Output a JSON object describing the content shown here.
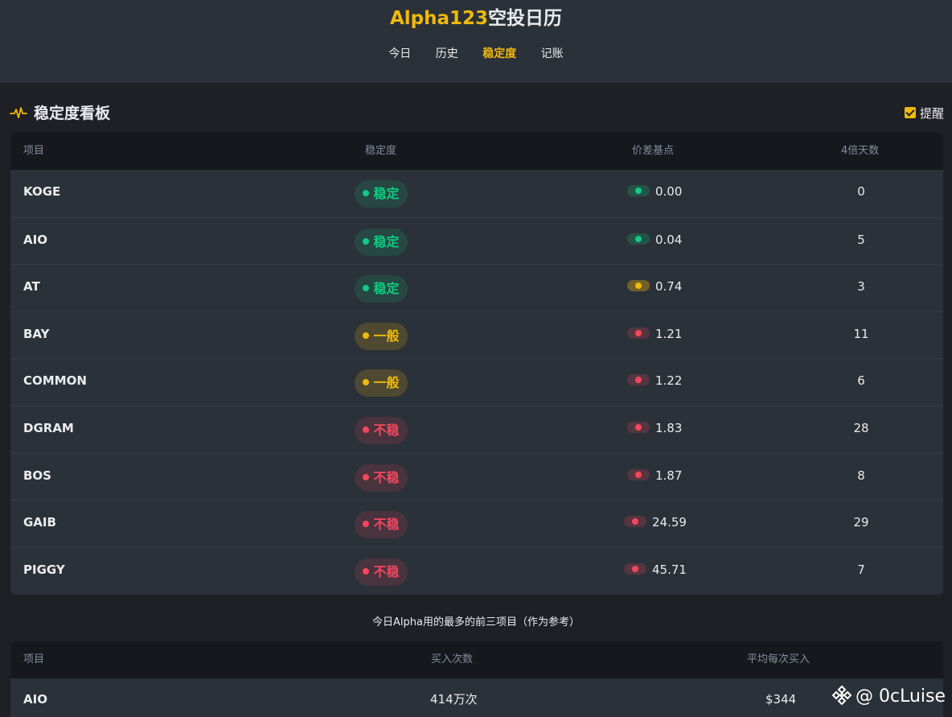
{
  "header": {
    "title_brand": "Alpha123",
    "title_rest": "空投日历",
    "nav": [
      "今日",
      "历史",
      "稳定度",
      "记账"
    ],
    "active_nav": "稳定度"
  },
  "board": {
    "title": "稳定度看板",
    "remind_label": "提醒",
    "remind_checked": true,
    "columns": [
      "项目",
      "稳定度",
      "价差基点",
      "4倍天数"
    ],
    "rows": [
      {
        "name": "KOGE",
        "status": "稳定",
        "level": "good",
        "spread": "0.00",
        "spread_level": "good",
        "days": "0"
      },
      {
        "name": "AIO",
        "status": "稳定",
        "level": "good",
        "spread": "0.04",
        "spread_level": "good",
        "days": "5"
      },
      {
        "name": "AT",
        "status": "稳定",
        "level": "good",
        "spread": "0.74",
        "spread_level": "mid",
        "days": "3"
      },
      {
        "name": "BAY",
        "status": "一般",
        "level": "mid",
        "spread": "1.21",
        "spread_level": "bad",
        "days": "11"
      },
      {
        "name": "COMMON",
        "status": "一般",
        "level": "mid",
        "spread": "1.22",
        "spread_level": "bad",
        "days": "6"
      },
      {
        "name": "DGRAM",
        "status": "不稳",
        "level": "bad",
        "spread": "1.83",
        "spread_level": "bad",
        "days": "28"
      },
      {
        "name": "BOS",
        "status": "不稳",
        "level": "bad",
        "spread": "1.87",
        "spread_level": "bad",
        "days": "8"
      },
      {
        "name": "GAIB",
        "status": "不稳",
        "level": "bad",
        "spread": "24.59",
        "spread_level": "bad",
        "days": "29"
      },
      {
        "name": "PIGGY",
        "status": "不稳",
        "level": "bad",
        "spread": "45.71",
        "spread_level": "bad",
        "days": "7"
      }
    ]
  },
  "top3": {
    "caption": "今日Alpha用的最多的前三项目（作为参考）",
    "columns": [
      "项目",
      "买入次数",
      "平均每次买入"
    ],
    "rows": [
      {
        "name": "AIO",
        "buys": "414万次",
        "avg": "$344"
      }
    ]
  },
  "watermark": {
    "text": "@ 0cLuise",
    "icon": "binance-logo-icon"
  },
  "colors": {
    "accent": "#f0b90b",
    "good": "#0ecb81",
    "mid": "#f0b90b",
    "bad": "#f6465d"
  }
}
